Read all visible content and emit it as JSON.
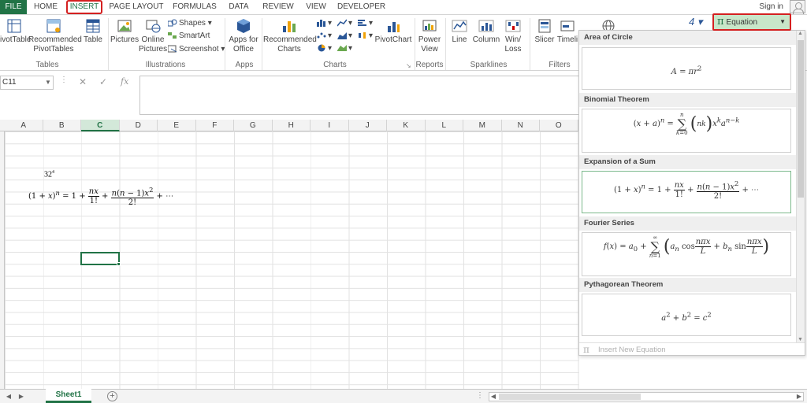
{
  "tabs": {
    "file": "FILE",
    "home": "HOME",
    "insert": "INSERT",
    "page_layout": "PAGE LAYOUT",
    "formulas": "FORMULAS",
    "data": "DATA",
    "review": "REVIEW",
    "view": "VIEW",
    "developer": "DEVELOPER"
  },
  "signin": "Sign in",
  "ribbon": {
    "pivottable": "ivotTable",
    "recommended_pivottables_1": "Recommended",
    "recommended_pivottables_2": "PivotTables",
    "table": "Table",
    "group_tables": "Tables",
    "pictures": "Pictures",
    "online_pictures_1": "Online",
    "online_pictures_2": "Pictures",
    "shapes": "Shapes",
    "smartart": "SmartArt",
    "screenshot": "Screenshot",
    "group_illustrations": "Illustrations",
    "apps_for_office_1": "Apps for",
    "apps_for_office_2": "Office",
    "group_apps": "Apps",
    "recommended_charts_1": "Recommended",
    "recommended_charts_2": "Charts",
    "pivotchart": "PivotChart",
    "group_charts": "Charts",
    "power_view_1": "Power",
    "power_view_2": "View",
    "group_reports": "Reports",
    "line": "Line",
    "column": "Column",
    "winloss_1": "Win/",
    "winloss_2": "Loss",
    "group_sparklines": "Sparklines",
    "slicer": "Slicer",
    "timeline": "Timeli",
    "group_filters": "Filters",
    "equation": "Equation"
  },
  "formula_bar": {
    "name_box": "C11",
    "cancel": "✕",
    "enter": "✓",
    "fx": "fx"
  },
  "grid": {
    "columns": [
      "A",
      "B",
      "C",
      "D",
      "E",
      "F",
      "G",
      "H",
      "I",
      "J",
      "K",
      "L",
      "M",
      "N",
      "O"
    ],
    "active_column": "C",
    "cell_b6_base": "32",
    "cell_b6_exp": "4"
  },
  "sheet_tab": "Sheet1",
  "gallery": {
    "sections": [
      {
        "title": "Area of Circle"
      },
      {
        "title": "Binomial Theorem"
      },
      {
        "title": "Expansion of a Sum"
      },
      {
        "title": "Fourier Series"
      },
      {
        "title": "Pythagorean Theorem"
      }
    ],
    "footer": "Insert New Equation"
  }
}
